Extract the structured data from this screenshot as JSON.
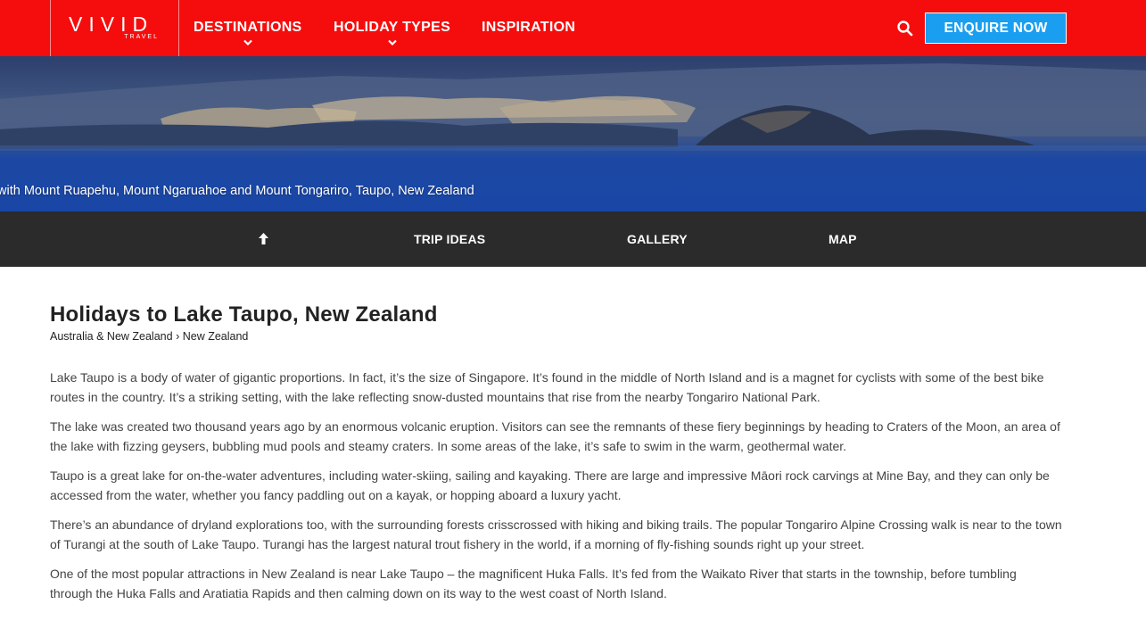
{
  "header": {
    "logo": {
      "main": "VIVID",
      "sub": "TRAVEL"
    },
    "nav": [
      {
        "label": "DESTINATIONS"
      },
      {
        "label": "HOLIDAY TYPES"
      },
      {
        "label": "INSPIRATION"
      }
    ],
    "enquire_label": "ENQUIRE NOW",
    "colors": {
      "brand_red": "#f50d0d",
      "button_blue": "#1a9ff0"
    }
  },
  "hero": {
    "caption": "with Mount Ruapehu, Mount Ngaruahoe and Mount Tongariro, Taupo, New Zealand"
  },
  "subnav": {
    "items": [
      {
        "label": "TRIP IDEAS"
      },
      {
        "label": "GALLERY"
      },
      {
        "label": "MAP"
      }
    ]
  },
  "main": {
    "title": "Holidays to Lake Taupo, New Zealand",
    "breadcrumb": {
      "parent": "Australia & New Zealand",
      "separator": "›",
      "current": "New Zealand"
    },
    "paragraphs": [
      "Lake Taupo is a body of water of gigantic proportions. In fact, it’s the size of Singapore. It’s found in the middle of North Island and is a magnet for cyclists with some of the best bike routes in the country. It’s a striking setting, with the lake reflecting snow-dusted mountains that rise from the nearby Tongariro National Park.",
      "The lake was created two thousand years ago by an enormous volcanic eruption. Visitors can see the remnants of these fiery beginnings by heading to Craters of the Moon, an area of the lake with fizzing geysers, bubbling mud pools and steamy craters. In some areas of the lake, it’s safe to swim in the warm, geothermal water.",
      "Taupo is a great lake for on-the-water adventures, including water-skiing, sailing and kayaking. There are large and impressive Māori rock carvings at Mine Bay, and they can only be accessed from the water, whether you fancy paddling out on a kayak, or hopping aboard a luxury yacht.",
      "There’s an abundance of dryland explorations too, with the surrounding forests crisscrossed with hiking and biking trails. The popular Tongariro Alpine Crossing walk is near to the town of Turangi at the south of Lake Taupo. Turangi has the largest natural trout fishery in the world, if a morning of fly-fishing sounds right up your street.",
      "One of the most popular attractions in New Zealand is near Lake Taupo – the magnificent Huka Falls. It’s fed from the Waikato River that starts in the township, before tumbling through the Huka Falls and Aratiatia Rapids and then calming down on its way to the west coast of North Island."
    ]
  }
}
